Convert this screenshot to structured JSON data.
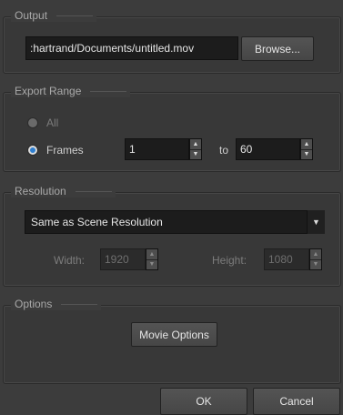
{
  "output": {
    "title": "Output",
    "path": ":hartrand/Documents/untitled.mov",
    "browse_label": "Browse..."
  },
  "export_range": {
    "title": "Export Range",
    "all_label": "All",
    "frames_label": "Frames",
    "from_value": "1",
    "to_label": "to",
    "to_value": "60",
    "selected": "Frames"
  },
  "resolution": {
    "title": "Resolution",
    "selected": "Same as Scene Resolution",
    "width_label": "Width:",
    "width_value": "1920",
    "height_label": "Height:",
    "height_value": "1080"
  },
  "options": {
    "title": "Options",
    "movie_options_label": "Movie Options"
  },
  "footer": {
    "ok_label": "OK",
    "cancel_label": "Cancel"
  },
  "icons": {
    "spin_up": "up-arrow-icon",
    "spin_down": "down-arrow-icon",
    "dropdown": "chevron-down-icon"
  }
}
